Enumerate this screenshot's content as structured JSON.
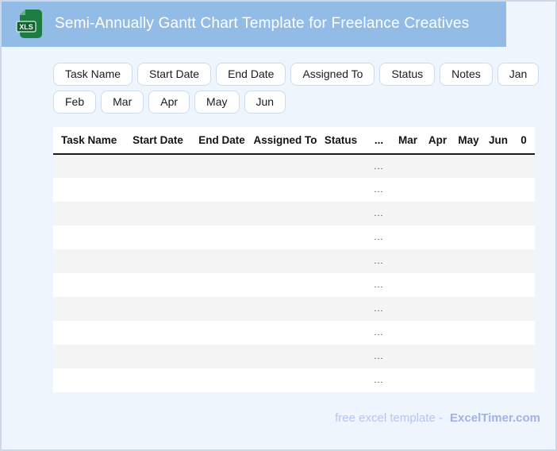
{
  "header": {
    "title": "Semi-Annually Gantt Chart Template for Freelance Creatives",
    "icon_label": "XLS"
  },
  "chips": [
    "Task Name",
    "Start Date",
    "End Date",
    "Assigned To",
    "Status",
    "Notes",
    "Jan",
    "Feb",
    "Mar",
    "Apr",
    "May",
    "Jun"
  ],
  "table": {
    "columns": [
      "Task Name",
      "Start Date",
      "End Date",
      "Assigned To",
      "Status",
      "...",
      "Mar",
      "Apr",
      "May",
      "Jun",
      "0"
    ],
    "rows": [
      [
        "",
        "",
        "",
        "",
        "",
        "...",
        "",
        "",
        "",
        "",
        ""
      ],
      [
        "",
        "",
        "",
        "",
        "",
        "...",
        "",
        "",
        "",
        "",
        ""
      ],
      [
        "",
        "",
        "",
        "",
        "",
        "...",
        "",
        "",
        "",
        "",
        ""
      ],
      [
        "",
        "",
        "",
        "",
        "",
        "...",
        "",
        "",
        "",
        "",
        ""
      ],
      [
        "",
        "",
        "",
        "",
        "",
        "...",
        "",
        "",
        "",
        "",
        ""
      ],
      [
        "",
        "",
        "",
        "",
        "",
        "...",
        "",
        "",
        "",
        "",
        ""
      ],
      [
        "",
        "",
        "",
        "",
        "",
        "...",
        "",
        "",
        "",
        "",
        ""
      ],
      [
        "",
        "",
        "",
        "",
        "",
        "...",
        "",
        "",
        "",
        "",
        ""
      ],
      [
        "",
        "",
        "",
        "",
        "",
        "...",
        "",
        "",
        "",
        "",
        ""
      ],
      [
        "",
        "",
        "",
        "",
        "",
        "...",
        "",
        "",
        "",
        "",
        ""
      ]
    ]
  },
  "footer": {
    "lead": "free excel template -",
    "brand": "ExcelTimer.com"
  },
  "colors": {
    "banner": "#92bce6",
    "page_bg": "#eef5fd",
    "page_border": "#ccd8e8",
    "chip_border": "#ccdcee",
    "stripe": "#f4f4f5",
    "header_rule": "#1a1a1a",
    "footer_text": "#b8c5f0",
    "footer_brand": "#a1b1ec",
    "icon_green": "#1b7d3f"
  }
}
